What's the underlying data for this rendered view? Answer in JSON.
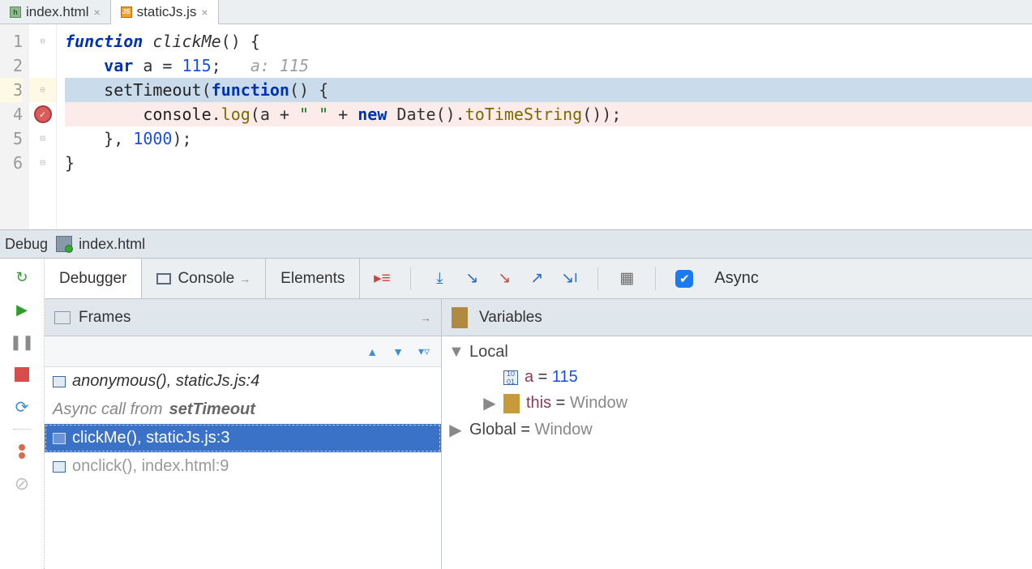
{
  "tabs": [
    {
      "label": "index.html",
      "type": "html",
      "active": false
    },
    {
      "label": "staticJs.js",
      "type": "js",
      "active": true
    }
  ],
  "code": {
    "lines": [
      "1",
      "2",
      "3",
      "4",
      "5",
      "6"
    ],
    "l1_kw1": "function",
    "l1_fn": "clickMe",
    "l1_rest": "() {",
    "l2_kw": "var",
    "l2_var": "a",
    "l2_eq": " = ",
    "l2_num": "115",
    "l2_semi": ";",
    "l2_hint": "a: 115",
    "l3_fn": "setTimeout",
    "l3_open": "(",
    "l3_kw": "function",
    "l3_rest": "() {",
    "l4_obj": "console",
    "l4_dot1": ".",
    "l4_log": "log",
    "l4_p1": "(a + ",
    "l4_str": "\" \"",
    "l4_p2": " + ",
    "l4_new": "new",
    "l4_date": " Date().",
    "l4_tts": "toTimeString",
    "l4_end": "());",
    "l5_close": "}, ",
    "l5_num": "1000",
    "l5_end": ");",
    "l6": "}"
  },
  "debugHeader": {
    "label": "Debug",
    "target": "index.html"
  },
  "subTabs": {
    "debugger": "Debugger",
    "console": "Console",
    "elements": "Elements",
    "async": "Async"
  },
  "panes": {
    "frames": "Frames",
    "variables": "Variables"
  },
  "frames": [
    {
      "text": "anonymous(), staticJs.js:4",
      "kind": "normal"
    },
    {
      "prefix": "Async call from ",
      "em": "setTimeout",
      "kind": "note"
    },
    {
      "text": "clickMe(), staticJs.js:3",
      "kind": "selected"
    },
    {
      "text": "onclick(), index.html:9",
      "kind": "dim"
    }
  ],
  "variables": {
    "local": "Local",
    "a_name": "a",
    "a_eq": " = ",
    "a_val": "115",
    "this_name": "this",
    "this_eq": " = ",
    "this_val": "Window",
    "global_name": "Global",
    "global_eq": " = ",
    "global_val": "Window"
  }
}
